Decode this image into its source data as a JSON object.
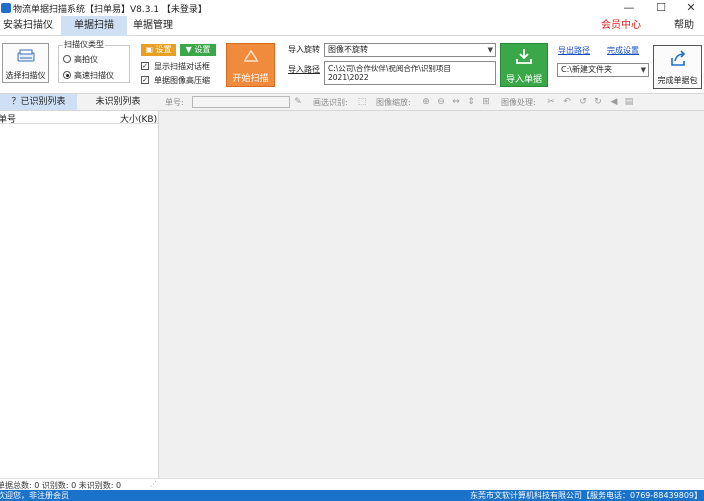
{
  "window": {
    "title": "物流单据扫描系统【扫单易】V8.3.1 【未登录】",
    "minimize": "—",
    "maximize": "☐",
    "close": "✕"
  },
  "menu": {
    "items": [
      "安装扫描仪",
      "单据扫描",
      "单据管理"
    ],
    "active_index": 1,
    "member_center": "会员中心",
    "help": "帮助"
  },
  "ribbon": {
    "select_scanner": "选择扫描仪",
    "scanner_type_label": "扫描仪类型",
    "radio_high_shot": "高拍仪",
    "radio_high_speed": "高速扫描仪",
    "radio_selected": "高速扫描仪",
    "settings_btn_1": "设置",
    "settings_btn_2": "设置",
    "show_scan_dialog": "显示扫描对话框",
    "compress_image": "单据图像高压缩",
    "start_scan": "开始扫描",
    "import_rotate_label": "导入旋转",
    "rotate_value": "图像不旋转",
    "import_path_label": "导入路径",
    "import_path_value": "C:\\公司\\合作伙伴\\祝阅合作\\识别项目 2021\\2022",
    "import_docs": "导入单据",
    "export_path_link": "导出路径",
    "complete_settings_link": "完成设置",
    "folder_value": "C:\\新建文件夹",
    "complete_pack": "完成单据包"
  },
  "tabs": {
    "recognized": "？已识别列表",
    "unrecognized": "未识别列表"
  },
  "toolbar": {
    "doc_no_label": "单号:",
    "doc_no_value": "",
    "box_select_label": "画选识别:",
    "zoom_label": "图像缩放:",
    "process_label": "图像处理:"
  },
  "list": {
    "col_doc_no": "单号",
    "col_size": "大小(KB)"
  },
  "counts": "单据总数: 0  识别数: 0  未识别数: 0",
  "status": {
    "welcome": "欢迎您，非注册会员",
    "company": "东莞市文软计算机科技有限公司【服务电话：0769-88439809】"
  },
  "colors": {
    "accent_orange": "#f08a3c",
    "accent_green": "#3aa848",
    "settings_orange": "#e8a023",
    "settings_green": "#3aa848",
    "status_blue": "#1b72c9",
    "member_red": "#d9231f"
  }
}
